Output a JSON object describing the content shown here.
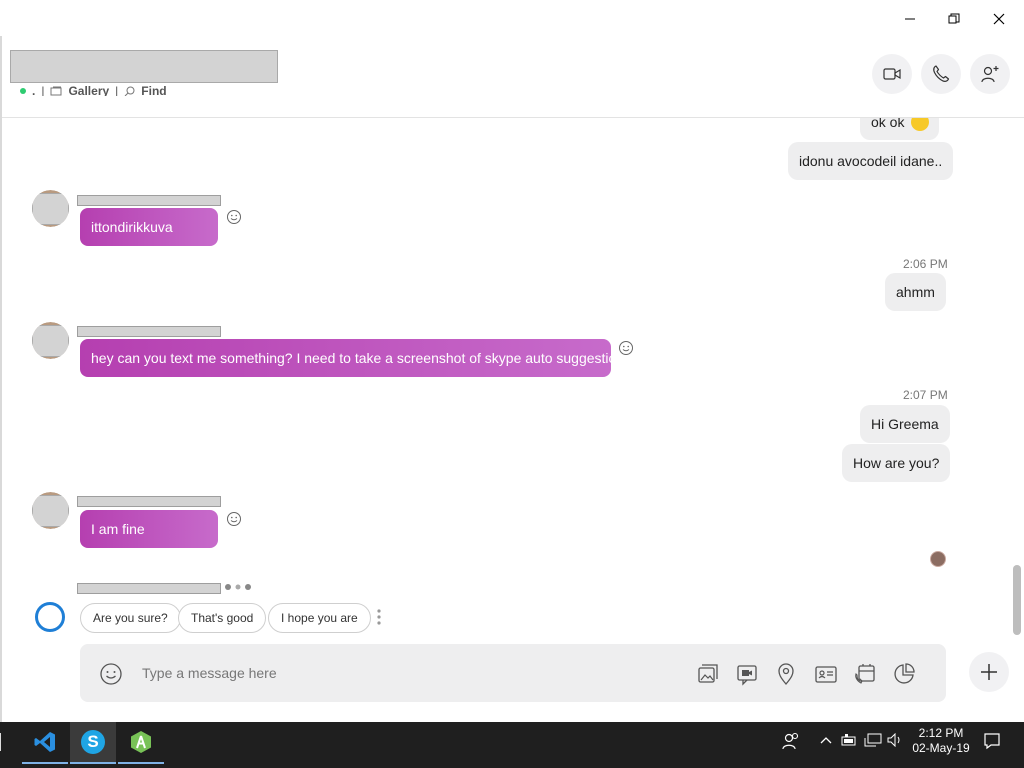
{
  "window": {
    "controls": [
      "minimize",
      "restore",
      "close"
    ]
  },
  "header": {
    "status_text": ".",
    "sep": "|",
    "gallery_label": "Gallery",
    "find_label": "Find",
    "buttons": [
      "video-call",
      "audio-call",
      "add-people"
    ]
  },
  "messages": {
    "out_1": "ok ok",
    "out_2": "idonu avocodeil idane..",
    "in_1": "ittondirikkuva",
    "time_1": "2:06 PM",
    "out_3": "ahmm",
    "in_2": "hey can you text me something? I need to take a screenshot of skype auto suggestions",
    "time_2": "2:07 PM",
    "out_4": "Hi Greema",
    "out_5": "How are you?",
    "in_3": "I am fine"
  },
  "suggestions": [
    "Are you sure?",
    "That's good",
    "I hope you are"
  ],
  "compose": {
    "placeholder": "Type a message here"
  },
  "taskbar": {
    "time": "2:12 PM",
    "date": "02-May-19"
  },
  "colors": {
    "incoming_start": "#b53fb0",
    "incoming_end": "#c76bcb",
    "online": "#2ecc71",
    "cortana": "#1f7fd6"
  }
}
